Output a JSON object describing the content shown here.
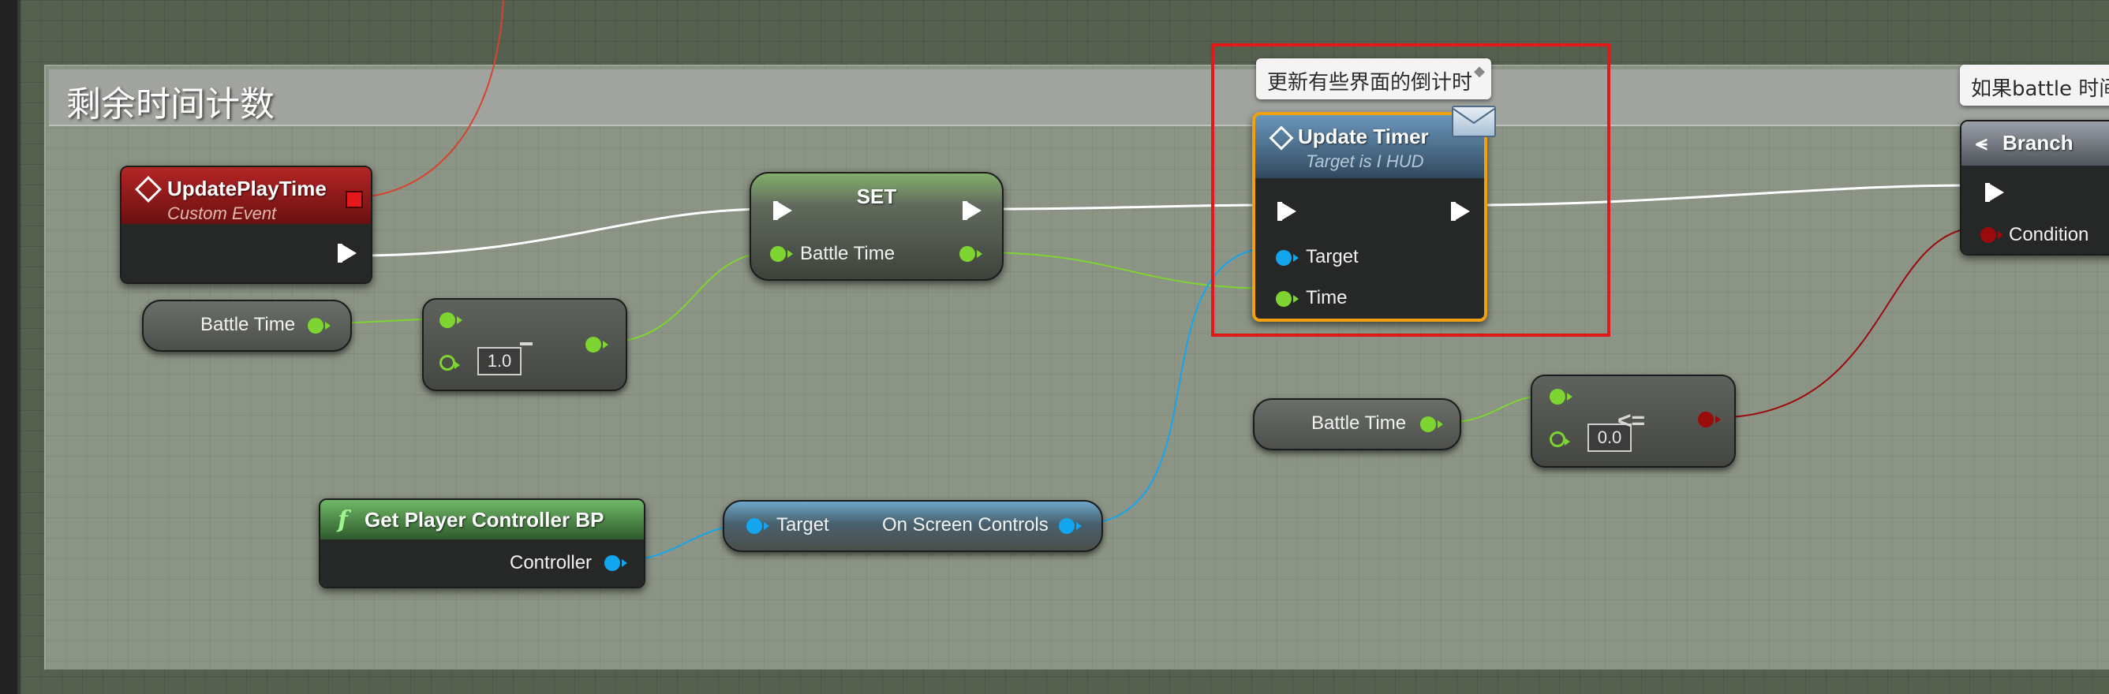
{
  "comment": {
    "title": "剩余时间计数"
  },
  "event_node": {
    "title": "UpdatePlayTime",
    "subtitle": "Custom Event"
  },
  "set_node": {
    "title": "SET",
    "pin_label": "Battle Time"
  },
  "battle_time_getter_1": {
    "label": "Battle Time"
  },
  "subtract_node": {
    "value": "1.0"
  },
  "update_timer_node": {
    "title": "Update Timer",
    "subtitle": "Target is I HUD",
    "pin_target": "Target",
    "pin_time": "Time",
    "tooltip": "更新有些界面的倒计时"
  },
  "branch_node": {
    "title": "Branch",
    "pin_condition": "Condition",
    "tooltip": "如果battle 时间"
  },
  "get_player_controller_node": {
    "title": "Get Player Controller BP",
    "pin_controller": "Controller"
  },
  "on_screen_controls_node": {
    "pin_target": "Target",
    "pin_output": "On Screen Controls"
  },
  "battle_time_getter_2": {
    "label": "Battle Time"
  },
  "compare_node": {
    "operator": "<=",
    "value": "0.0"
  },
  "colors": {
    "exec_wire": "#ffffff",
    "float_wire": "#7ed430",
    "object_wire": "#13a6ef",
    "bool_wire": "#9c0b0b",
    "highlight": "#e31818",
    "event_header": "#9e1a1a"
  },
  "icons": [
    "event-diamond-icon",
    "function-f-icon",
    "branch-icon",
    "message-envelope-icon",
    "pin-icon"
  ]
}
